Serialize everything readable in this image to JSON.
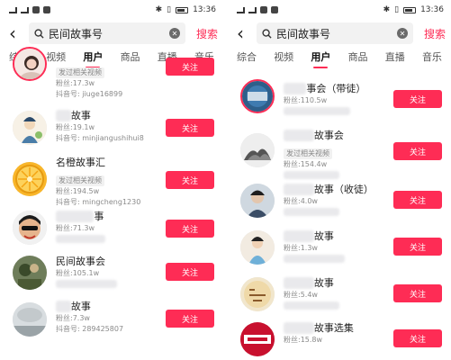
{
  "status": {
    "time_left": "13:36",
    "time_right": "13:36"
  },
  "search": {
    "query": "民间故事号",
    "action_label": "搜索"
  },
  "tabs": [
    "综合",
    "视频",
    "用户",
    "商品",
    "直播",
    "音乐"
  ],
  "left_results": [
    {
      "name": "",
      "tagline": "发过相关视频",
      "fans": "",
      "account": "抖音号: jiuge16899",
      "follow": "关注"
    },
    {
      "name": "故事",
      "tagline": "",
      "fans": "粉丝:19.1w",
      "account": "抖音号: minjiangushihui8",
      "follow": "关注"
    },
    {
      "name": "名橙故事汇",
      "tagline": "发过相关视频",
      "fans": "粉丝:194.5w",
      "account": "抖音号: mingcheng1230",
      "follow": "关注"
    },
    {
      "name": "事",
      "tagline": "",
      "fans": "粉丝:71.3w",
      "account": "",
      "follow": "关注"
    },
    {
      "name": "民间故事会",
      "tagline": "",
      "fans": "粉丝:105.1w",
      "account": "",
      "follow": "关注"
    },
    {
      "name": "故事",
      "tagline": "",
      "fans": "粉丝:7.3w",
      "account": "抖音号: 289425807",
      "follow": "关注"
    }
  ],
  "left_partial_fans": "粉丝:17.3w",
  "right_results": [
    {
      "name": "事会（带徒）",
      "tagline": "",
      "fans": "粉丝:110.5w",
      "account": "",
      "follow": "关注"
    },
    {
      "name": "故事会",
      "tagline": "发过相关视频",
      "fans": "粉丝:154.4w",
      "account": "",
      "follow": "关注"
    },
    {
      "name": "故事（收徒）",
      "tagline": "",
      "fans": "粉丝:4.0w",
      "account": "",
      "follow": "关注"
    },
    {
      "name": "故事",
      "tagline": "",
      "fans": "粉丝:1.3w",
      "account": "",
      "follow": "关注"
    },
    {
      "name": "故事",
      "tagline": "",
      "fans": "粉丝:5.4w",
      "account": "",
      "follow": "关注"
    },
    {
      "name": "故事选集",
      "tagline": "",
      "fans": "粉丝:15.8w",
      "account": "",
      "follow": "关注"
    }
  ],
  "colors": {
    "accent": "#fe2c55",
    "tag_bg": "#f1f1f1",
    "search_bg": "#f2f2f2"
  }
}
